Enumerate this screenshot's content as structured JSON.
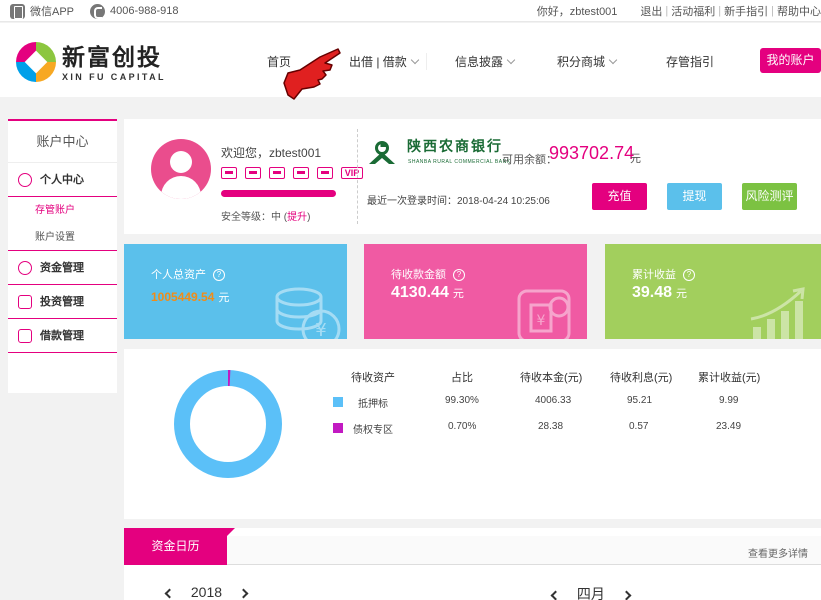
{
  "topbar": {
    "wechat_app": "微信APP",
    "phone": "4006-988-918",
    "greeting": "你好，zbtest001",
    "links": [
      "退出",
      "活动福利",
      "新手指引",
      "帮助中心"
    ]
  },
  "header": {
    "logo_cn": "新富创投",
    "logo_en": "XIN FU CAPITAL",
    "nav": [
      "首页",
      "出借 | 借款",
      "信息披露",
      "积分商城",
      "存管指引"
    ],
    "my_account": "我的账户"
  },
  "sidebar": {
    "title": "账户中心",
    "personal_center": "个人中心",
    "sub_items": [
      "存管账户",
      "账户设置"
    ],
    "fund_mgmt": "资金管理",
    "invest_mgmt": "投资管理",
    "loan_mgmt": "借款管理"
  },
  "profile": {
    "welcome": "欢迎您，zbtest001",
    "vip": "VIP",
    "security_prefix": "安全等级：中 (",
    "upgrade": "提升",
    "security_suffix": ")",
    "bank_name": "陕西农商银行",
    "bank_en": "SHANBA RURAL COMMERCIAL BANK",
    "balance_label": "可用余额：",
    "balance": "993702.74",
    "balance_unit": "元",
    "last_login": "最近一次登录时间：2018-04-24 10:25:06",
    "recharge": "充值",
    "withdraw": "提现",
    "risk_test": "风险测评"
  },
  "tiles": [
    {
      "label": "个人总资产",
      "value": "1005449.54",
      "unit": "元"
    },
    {
      "label": "待收款金额",
      "value": "4130.44",
      "unit": "元"
    },
    {
      "label": "累计收益",
      "value": "39.48",
      "unit": "元"
    }
  ],
  "assets": {
    "headers": [
      "待收资产",
      "占比",
      "待收本金(元)",
      "待收利息(元)",
      "累计收益(元)"
    ],
    "rows": [
      {
        "name": "抵押标",
        "ratio": "99.30%",
        "principal": "4006.33",
        "interest": "95.21",
        "earnings": "9.99",
        "color": "#5bc0f8"
      },
      {
        "name": "债权专区",
        "ratio": "0.70%",
        "principal": "28.38",
        "interest": "0.57",
        "earnings": "23.49",
        "color": "#c21ac2"
      }
    ],
    "donut_share": [
      0.993,
      0.007
    ]
  },
  "calendar": {
    "tab": "资金日历",
    "more": "查看更多详情",
    "year": "2018",
    "month": "四月"
  },
  "colors": {
    "accent": "#e4007f",
    "blue": "#5bc0eb",
    "green": "#7cc242"
  }
}
